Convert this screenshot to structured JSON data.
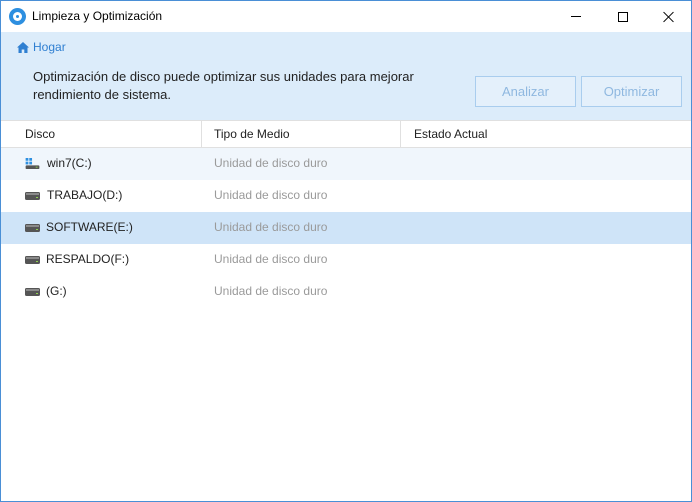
{
  "window": {
    "title": "Limpieza y Optimización",
    "icon": "cleanup-app-icon"
  },
  "banner": {
    "breadcrumb": "Hogar",
    "description": "Optimización de disco puede optimizar sus unidades para mejorar rendimiento de sistema.",
    "analyze_label": "Analizar",
    "optimize_label": "Optimizar"
  },
  "table": {
    "columns": [
      "Disco",
      "Tipo de Medio",
      "Estado Actual"
    ],
    "rows": [
      {
        "name": "win7(C:)",
        "media": "Unidad de disco duro",
        "status": "",
        "icon": "system-drive-icon"
      },
      {
        "name": "TRABAJO(D:)",
        "media": "Unidad de disco duro",
        "status": "",
        "icon": "hard-drive-icon"
      },
      {
        "name": "SOFTWARE(E:)",
        "media": "Unidad de disco duro",
        "status": "",
        "icon": "hard-drive-icon"
      },
      {
        "name": "RESPALDO(F:)",
        "media": "Unidad de disco duro",
        "status": "",
        "icon": "hard-drive-icon"
      },
      {
        "name": "(G:)",
        "media": "Unidad de disco duro",
        "status": "",
        "icon": "hard-drive-icon"
      }
    ],
    "selected_index": 2
  },
  "colors": {
    "accent": "#2f7fd1",
    "banner_bg": "#dcecfa",
    "selected_row": "#cfe4f8"
  }
}
